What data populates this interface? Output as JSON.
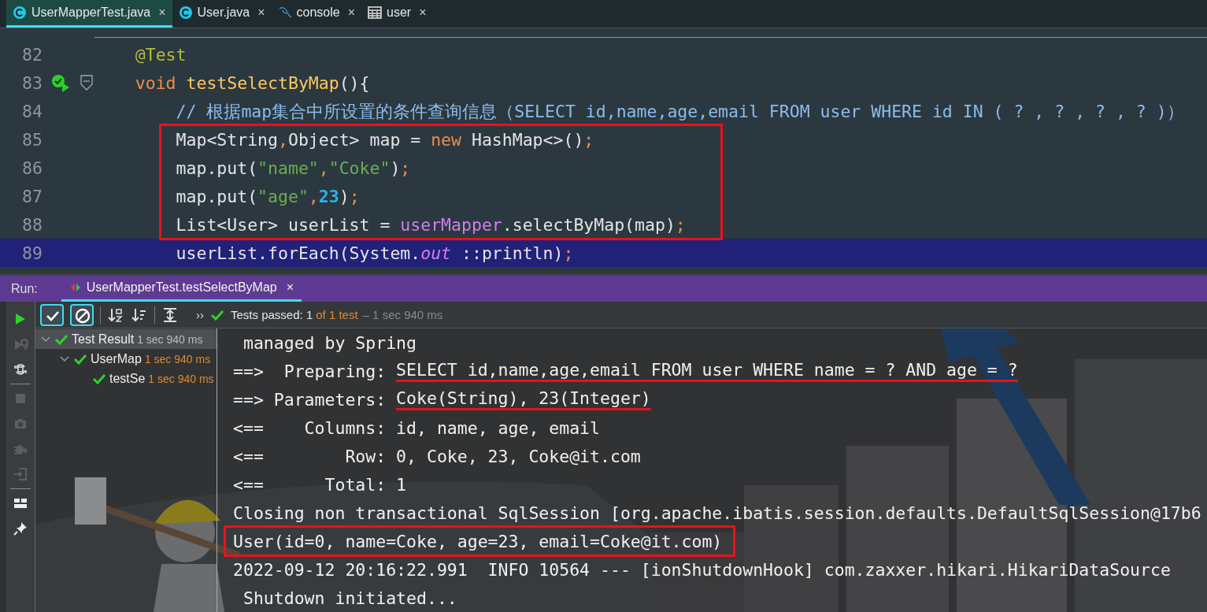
{
  "tabs": [
    {
      "label": "UserMapperTest.java",
      "kind": "class",
      "close": "×",
      "selected": true
    },
    {
      "label": "User.java",
      "kind": "class",
      "close": "×",
      "selected": false
    },
    {
      "label": "console",
      "kind": "database",
      "close": "×",
      "selected": false
    },
    {
      "label": "user",
      "kind": "table",
      "close": "×",
      "selected": false
    }
  ],
  "editor": {
    "lines": [
      {
        "number": "82",
        "kind": "code",
        "current": false,
        "boxed": false,
        "tokens": [
          {
            "t": "    @Test",
            "kind": "annotation"
          }
        ]
      },
      {
        "number": "83",
        "kind": "test-method",
        "current": false,
        "boxed": false,
        "tokens": [
          {
            "t": "    void",
            "kind": "keyword"
          },
          {
            "t": " testSelectByMap",
            "kind": "declaration"
          },
          {
            "t": "(){",
            "kind": "plain"
          }
        ]
      },
      {
        "number": "84",
        "kind": "code",
        "current": false,
        "boxed": false,
        "tokens": [
          {
            "t": "        // 根据map集合中所设置的条件查询信息（SELECT id,name,age,email FROM user WHERE id IN ( ? , ? , ? , ? )）",
            "kind": "comment"
          }
        ]
      },
      {
        "number": "85",
        "kind": "code",
        "current": false,
        "boxed": true,
        "tokens": [
          {
            "t": "        Map<String",
            "kind": "plain"
          },
          {
            "t": ",",
            "kind": "punct"
          },
          {
            "t": "Object> map = ",
            "kind": "plain"
          },
          {
            "t": "new",
            "kind": "keyword"
          },
          {
            "t": " HashMap<>()",
            "kind": "plain"
          },
          {
            "t": ";",
            "kind": "punct"
          }
        ]
      },
      {
        "number": "86",
        "kind": "code",
        "current": false,
        "boxed": true,
        "tokens": [
          {
            "t": "        map.put(",
            "kind": "plain"
          },
          {
            "t": "\"name\"",
            "kind": "string"
          },
          {
            "t": ",",
            "kind": "punct"
          },
          {
            "t": "\"Coke\"",
            "kind": "string"
          },
          {
            "t": ")",
            "kind": "plain"
          },
          {
            "t": ";",
            "kind": "punct"
          }
        ]
      },
      {
        "number": "87",
        "kind": "code",
        "current": false,
        "boxed": true,
        "tokens": [
          {
            "t": "        map.put(",
            "kind": "plain"
          },
          {
            "t": "\"age\"",
            "kind": "string"
          },
          {
            "t": ",",
            "kind": "punct"
          },
          {
            "t": "23",
            "kind": "number"
          },
          {
            "t": ")",
            "kind": "plain"
          },
          {
            "t": ";",
            "kind": "punct"
          }
        ]
      },
      {
        "number": "88",
        "kind": "code",
        "current": false,
        "boxed": true,
        "tokens": [
          {
            "t": "        List<User> userList = ",
            "kind": "plain"
          },
          {
            "t": "userMapper",
            "kind": "field"
          },
          {
            "t": ".selectByMap(map)",
            "kind": "plain"
          },
          {
            "t": ";",
            "kind": "punct"
          }
        ]
      },
      {
        "number": "89",
        "kind": "code",
        "current": true,
        "boxed": false,
        "tokens": [
          {
            "t": "        userList.forEach(System.",
            "kind": "plain"
          },
          {
            "t": "out",
            "kind": "static"
          },
          {
            "t": " ::println)",
            "kind": "plain"
          },
          {
            "t": ";",
            "kind": "punct"
          }
        ]
      }
    ]
  },
  "run_panel": {
    "label": "Run:",
    "tab": {
      "label": "UserMapperTest.testSelectByMap",
      "close": "×",
      "selected": true
    },
    "toolbar": {
      "toggles": [
        {
          "kind": "passed",
          "on": true
        },
        {
          "kind": "ignored",
          "on": true
        }
      ],
      "actions": [
        {
          "kind": "sort-alpha"
        },
        {
          "kind": "sort-duration"
        },
        {
          "kind": "expand"
        }
      ],
      "overflow": "››",
      "status": "Tests passed: 1",
      "count": "of 1 test",
      "duration": "– 1 sec 940 ms"
    },
    "side_actions": [
      {
        "kind": "run",
        "disabled": false
      },
      {
        "kind": "rerun-failed",
        "disabled": true
      },
      {
        "kind": "toggle-auto",
        "disabled": false
      },
      {
        "kind": "stop",
        "disabled": true
      },
      {
        "kind": "camera",
        "disabled": true
      },
      {
        "kind": "bug",
        "disabled": true
      },
      {
        "kind": "exit",
        "disabled": true
      },
      {
        "kind": "layout",
        "disabled": false
      },
      {
        "kind": "pin",
        "disabled": false
      }
    ],
    "test_tree": [
      {
        "label": "Test Result",
        "time": "1 sec 940 ms",
        "selected": true,
        "expanded": true,
        "children": [
          {
            "label": "UserMap",
            "time": "1 sec 940 ms",
            "selected": false,
            "expanded": true,
            "children": [
              {
                "label": "testSe",
                "time": "1 sec 940 ms",
                "selected": false
              }
            ]
          }
        ]
      }
    ],
    "console": [
      {
        "boxed": false,
        "segments": [
          {
            "t": " managed by Spring",
            "underlined": false
          }
        ]
      },
      {
        "boxed": false,
        "segments": [
          {
            "t": "==>  Preparing: ",
            "underlined": false
          },
          {
            "t": "SELECT id,name,age,email FROM user WHERE name = ? AND age = ?",
            "underlined": true
          }
        ]
      },
      {
        "boxed": false,
        "segments": [
          {
            "t": "==> Parameters: ",
            "underlined": false
          },
          {
            "t": "Coke(String), 23(Integer)",
            "underlined": true
          }
        ]
      },
      {
        "boxed": false,
        "segments": [
          {
            "t": "<==    Columns: id, name, age, email",
            "underlined": false
          }
        ]
      },
      {
        "boxed": false,
        "segments": [
          {
            "t": "<==        Row: 0, Coke, 23, Coke@it.com",
            "underlined": false
          }
        ]
      },
      {
        "boxed": false,
        "segments": [
          {
            "t": "<==      Total: 1",
            "underlined": false
          }
        ]
      },
      {
        "boxed": false,
        "segments": [
          {
            "t": "Closing non transactional SqlSession [org.apache.ibatis.session.defaults.DefaultSqlSession@17b6",
            "underlined": false
          }
        ]
      },
      {
        "boxed": true,
        "segments": [
          {
            "t": "User(id=0, name=Coke, age=23, email=Coke@it.com)",
            "underlined": false
          }
        ]
      },
      {
        "boxed": false,
        "segments": [
          {
            "t": "2022-09-12 20:16:22.991  INFO 10564 --- [ionShutdownHook] com.zaxxer.hikari.HikariDataSource",
            "underlined": false
          }
        ]
      },
      {
        "boxed": false,
        "segments": [
          {
            "t": " Shutdown initiated...",
            "underlined": false
          }
        ]
      }
    ]
  }
}
